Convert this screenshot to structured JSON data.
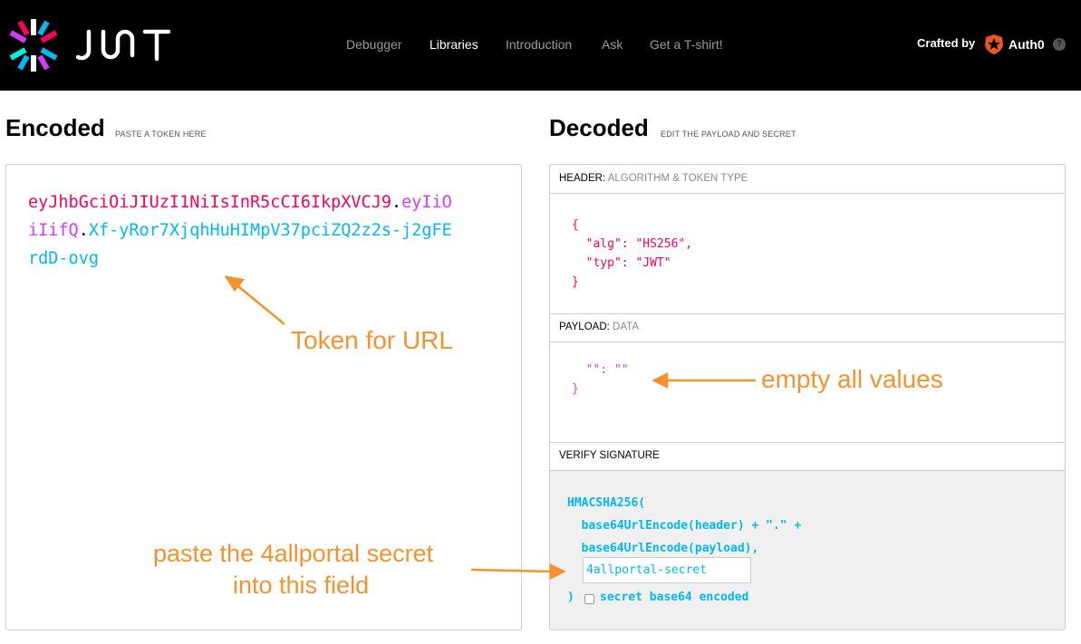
{
  "brand": {
    "logo_text": "JWT"
  },
  "nav": {
    "items": [
      {
        "label": "Debugger",
        "active": false
      },
      {
        "label": "Libraries",
        "active": true
      },
      {
        "label": "Introduction",
        "active": false
      },
      {
        "label": "Ask",
        "active": false
      },
      {
        "label": "Get a T-shirt!",
        "active": false
      }
    ],
    "crafted_by": "Crafted by",
    "partner": "Auth0",
    "help": "?"
  },
  "encoded": {
    "title": "Encoded",
    "subtitle": "PASTE A TOKEN HERE",
    "token": {
      "header": "eyJhbGciOiJIUzI1NiIsInR5cCI6IkpXVCJ9",
      "payload": "eyIiOiIifQ",
      "signature": "Xf-yRor7XjqhHuHIMpV37pciZQ2z2s-j2gFErdD-ovg",
      "dot": "."
    }
  },
  "decoded": {
    "title": "Decoded",
    "subtitle": "EDIT THE PAYLOAD AND SECRET",
    "header": {
      "label": "HEADER:",
      "label_muted": "ALGORITHM & TOKEN TYPE",
      "code": "{\n  \"alg\": \"HS256\",\n  \"typ\": \"JWT\"\n}"
    },
    "payload": {
      "label": "PAYLOAD:",
      "label_muted": "DATA",
      "code": "  \"\": \"\"\n}"
    },
    "verify": {
      "label": "VERIFY SIGNATURE",
      "code": "HMACSHA256(\n  base64UrlEncode(header) + \".\" +\n  base64UrlEncode(payload),",
      "secret_value": "4allportal-secret",
      "close_paren": ")",
      "base64_label": "secret base64 encoded"
    }
  },
  "annotations": {
    "token_note": "Token for URL",
    "payload_note": "empty all values",
    "secret_note_line1": "paste the 4allportal secret",
    "secret_note_line2": "into this field"
  },
  "colors": {
    "header": "#fb015b",
    "payload": "#d63aff",
    "signature": "#00b9f1",
    "annotation": "#f5922f",
    "topbar": "#000000"
  }
}
